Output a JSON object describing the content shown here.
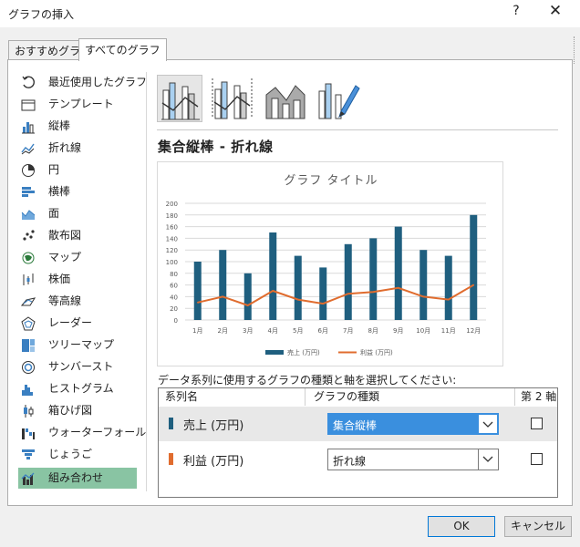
{
  "window": {
    "title": "グラフの挿入",
    "help_label": "?",
    "close_label": "✕"
  },
  "tabs": [
    {
      "label": "おすすめグラフ",
      "active": false
    },
    {
      "label": "すべてのグラフ",
      "active": true
    }
  ],
  "sidebar": {
    "items": [
      {
        "label": "最近使用したグラフ",
        "icon": "recent-icon"
      },
      {
        "label": "テンプレート",
        "icon": "folder-icon"
      },
      {
        "label": "縦棒",
        "icon": "column-chart-icon"
      },
      {
        "label": "折れ線",
        "icon": "line-chart-icon"
      },
      {
        "label": "円",
        "icon": "pie-chart-icon"
      },
      {
        "label": "横棒",
        "icon": "bar-chart-icon"
      },
      {
        "label": "面",
        "icon": "area-chart-icon"
      },
      {
        "label": "散布図",
        "icon": "scatter-chart-icon"
      },
      {
        "label": "マップ",
        "icon": "map-chart-icon"
      },
      {
        "label": "株価",
        "icon": "stock-chart-icon"
      },
      {
        "label": "等高線",
        "icon": "surface-chart-icon"
      },
      {
        "label": "レーダー",
        "icon": "radar-chart-icon"
      },
      {
        "label": "ツリーマップ",
        "icon": "treemap-chart-icon"
      },
      {
        "label": "サンバースト",
        "icon": "sunburst-chart-icon"
      },
      {
        "label": "ヒストグラム",
        "icon": "histogram-chart-icon"
      },
      {
        "label": "箱ひげ図",
        "icon": "box-whisker-chart-icon"
      },
      {
        "label": "ウォーターフォール",
        "icon": "waterfall-chart-icon"
      },
      {
        "label": "じょうご",
        "icon": "funnel-chart-icon"
      },
      {
        "label": "組み合わせ",
        "icon": "combo-chart-icon",
        "selected": true
      }
    ]
  },
  "chart_type_title": "集合縦棒 - 折れ線",
  "chart_data": {
    "type": "bar",
    "title": "グラフ タイトル",
    "categories": [
      "1月",
      "2月",
      "3月",
      "4月",
      "5月",
      "6月",
      "7月",
      "8月",
      "9月",
      "10月",
      "11月",
      "12月"
    ],
    "series": [
      {
        "name": "売上 (万円)",
        "type": "bar",
        "values": [
          100,
          120,
          80,
          150,
          110,
          90,
          130,
          140,
          160,
          120,
          110,
          180
        ]
      },
      {
        "name": "利益 (万円)",
        "type": "line",
        "values": [
          30,
          40,
          25,
          50,
          35,
          28,
          45,
          48,
          55,
          40,
          35,
          60
        ]
      }
    ],
    "ylim": [
      0,
      200
    ],
    "yticks": [
      0,
      20,
      40,
      60,
      80,
      100,
      120,
      140,
      160,
      180,
      200
    ],
    "grid": true,
    "legend": "bottom",
    "colors": {
      "bar": "#1f5f7f",
      "line": "#e06c2e"
    }
  },
  "series_config": {
    "instruction": "データ系列に使用するグラフの種類と軸を選択してください:",
    "headers": {
      "name": "系列名",
      "type": "グラフの種類",
      "secondary": "第 2 軸"
    },
    "rows": [
      {
        "name": "売上 (万円)",
        "chart_type": "集合縦棒",
        "secondary_axis": false,
        "color": "#1f5f7f"
      },
      {
        "name": "利益 (万円)",
        "chart_type": "折れ線",
        "secondary_axis": false,
        "color": "#e06c2e"
      }
    ]
  },
  "buttons": {
    "ok": "OK",
    "cancel": "キャンセル"
  }
}
